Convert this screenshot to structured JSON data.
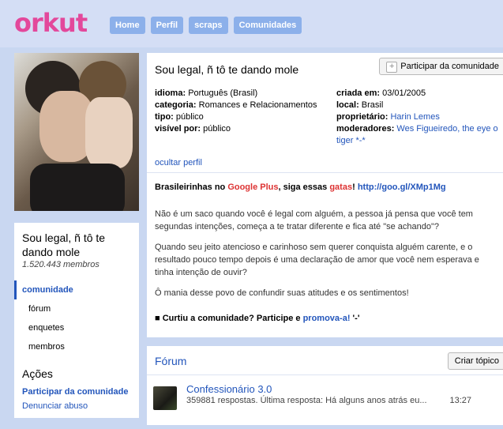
{
  "brand": "orkut",
  "nav": [
    "Home",
    "Perfil",
    "scraps",
    "Comunidades"
  ],
  "community": {
    "title": "Sou legal, ñ tô te dando mole",
    "members": "1.520.443 membros"
  },
  "menu": [
    "comunidade",
    "fórum",
    "enquetes",
    "membros"
  ],
  "acoes": {
    "title": "Ações",
    "items": [
      "Participar da comunidade",
      "Denunciar abuso"
    ]
  },
  "main": {
    "title": "Sou legal, ñ tô te dando mole",
    "join_button": "Participar da comunidade",
    "info": {
      "idioma_label": "idioma:",
      "idioma": "Português (Brasil)",
      "categoria_label": "categoria:",
      "categoria": "Romances e Relacionamentos",
      "tipo_label": "tipo:",
      "tipo": "público",
      "visivel_label": "visível por:",
      "visivel": "público",
      "criada_label": "criada em:",
      "criada": "03/01/2005",
      "local_label": "local:",
      "local": "Brasil",
      "proprietario_label": "proprietário:",
      "proprietario": "Harin Lemes",
      "moderadores_label": "moderadores:",
      "moderadores": "Wes Figueiredo, the eye o",
      "moderadores_cont": "tiger *-*"
    },
    "hide_profile": "ocultar perfil",
    "promo": {
      "prefix": "Brasileirinhas no ",
      "google": "Google Plus",
      "middle": ", siga essas ",
      "gatas": "gatas",
      "suffix": "!  ",
      "url": "http://goo.gl/XMp1Mg"
    },
    "description": [
      " Não é um saco quando você é legal com alguém, a pessoa já pensa que você tem segundas intenções, começa a te tratar diferente e fica até \"se achando\"?",
      "Quando seu jeito atencioso e carinhoso sem querer conquista alguém carente, e o resultado pouco tempo depois é uma declaração de amor que você nem esperava e tinha intenção de ouvir?",
      "Ô mania desse povo de confundir suas atitudes e os sentimentos!"
    ],
    "cta": {
      "prefix": "■ Curtiu a comunidade? Participe e ",
      "link": "promova-a!",
      "suffix": " '-'"
    }
  },
  "forum": {
    "title": "Fórum",
    "create_button": "Criar tópico",
    "topics": [
      {
        "name": "Confessionário 3.0",
        "meta": "359881 respostas.   Última resposta: Há alguns anos atrás eu...",
        "time": "13:27"
      }
    ]
  }
}
